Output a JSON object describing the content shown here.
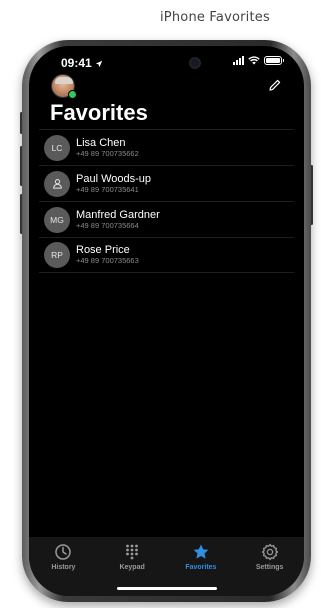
{
  "caption": "iPhone Favorites",
  "status_bar": {
    "time": "09:41"
  },
  "header": {
    "title": "Favorites",
    "edit_icon": "pencil-icon"
  },
  "contacts": [
    {
      "initials": "LC",
      "name": "Lisa Chen",
      "phone": "+49 89 700735662",
      "avatar_icon": ""
    },
    {
      "initials": "",
      "name": "Paul Woods-up",
      "phone": "+49 89 700735641",
      "avatar_icon": "person-icon"
    },
    {
      "initials": "MG",
      "name": "Manfred Gardner",
      "phone": "+49 89 700735664",
      "avatar_icon": ""
    },
    {
      "initials": "RP",
      "name": "Rose Price",
      "phone": "+49 89 700735663",
      "avatar_icon": ""
    }
  ],
  "tabs": [
    {
      "label": "History",
      "icon": "clock-icon",
      "active": false
    },
    {
      "label": "Keypad",
      "icon": "keypad-icon",
      "active": false
    },
    {
      "label": "Favorites",
      "icon": "star-icon",
      "active": true
    },
    {
      "label": "Settings",
      "icon": "gear-icon",
      "active": false
    }
  ],
  "colors": {
    "accent": "#2f8fe0",
    "background": "#000000",
    "tabbar": "#161616",
    "presence": "#34c759"
  }
}
